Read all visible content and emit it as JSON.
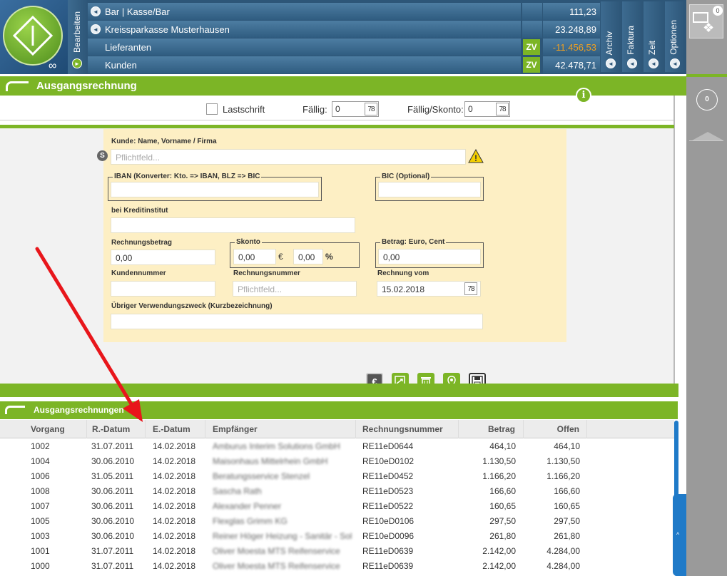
{
  "toolbar": {
    "edit_label": "Bearbeiten",
    "tabs": [
      "Archiv",
      "Faktura",
      "Zeit",
      "Optionen"
    ]
  },
  "accounts": [
    {
      "name": "Bar | Kasse/Bar",
      "badge": "",
      "amount": "111,23",
      "negative": false
    },
    {
      "name": "Kreissparkasse Musterhausen",
      "badge": "",
      "amount": "23.248,89",
      "negative": false
    },
    {
      "name": "Lieferanten",
      "badge": "ZV",
      "amount": "-11.456,53",
      "negative": true
    },
    {
      "name": "Kunden",
      "badge": "ZV",
      "amount": "42.478,71",
      "negative": false
    }
  ],
  "right_panel": {
    "mail_count": "0",
    "circle_count": "0"
  },
  "section": {
    "title": "Ausgangsrechnung",
    "info_icon": "i"
  },
  "options": {
    "lastschrift_label": "Lastschrift",
    "faellig_label": "Fällig:",
    "faellig_value": "0",
    "faellig_skonto_label": "Fällig/Skonto:",
    "faellig_skonto_value": "0",
    "cal_glyph": "78"
  },
  "form": {
    "kunde_label": "Kunde: Name, Vorname / Firma",
    "kunde_placeholder": "Pflichtfeld...",
    "s_badge": "S",
    "iban_legend": "IBAN (Konverter: Kto. => IBAN, BLZ => BIC",
    "bic_legend": "BIC (Optional)",
    "kreditinstitut_label": "bei Kreditinstitut",
    "rechnungsbetrag_label": "Rechnungsbetrag",
    "rechnungsbetrag_value": "0,00",
    "skonto_legend": "Skonto",
    "skonto_value": "0,00",
    "skonto_currency": "€",
    "skonto_percent_value": "0,00",
    "skonto_percent": "%",
    "betrag_legend": "Betrag: Euro, Cent",
    "betrag_value": "0,00",
    "kundennummer_label": "Kundennummer",
    "rechnungsnummer_label": "Rechnungsnummer",
    "rechnungsnummer_placeholder": "Pflichtfeld...",
    "rechnung_vom_label": "Rechnung vom",
    "rechnung_vom_value": "15.02.2018",
    "verwendung_label": "Übriger Verwendungszweck (Kurzbezeichnung)"
  },
  "list": {
    "title": "Ausgangsrechnungen",
    "columns": [
      "Vorgang",
      "R.-Datum",
      "E.-Datum",
      "Empfänger",
      "Rechnungsnummer",
      "Betrag",
      "Offen"
    ],
    "rows": [
      {
        "vorgang": "1002",
        "rdatum": "31.07.2011",
        "edatum": "14.02.2018",
        "empfaenger": "Amburus Interim Solutions GmbH",
        "nummer": "RE11eD0644",
        "betrag": "464,10",
        "offen": "464,10"
      },
      {
        "vorgang": "1004",
        "rdatum": "30.06.2010",
        "edatum": "14.02.2018",
        "empfaenger": "Maisonhaus Mittelrhein GmbH",
        "nummer": "RE10eD0102",
        "betrag": "1.130,50",
        "offen": "1.130,50"
      },
      {
        "vorgang": "1006",
        "rdatum": "31.05.2011",
        "edatum": "14.02.2018",
        "empfaenger": "Beratungsservice Stenzel",
        "nummer": "RE11eD0452",
        "betrag": "1.166,20",
        "offen": "1.166,20"
      },
      {
        "vorgang": "1008",
        "rdatum": "30.06.2011",
        "edatum": "14.02.2018",
        "empfaenger": "Sascha Rath",
        "nummer": "RE11eD0523",
        "betrag": "166,60",
        "offen": "166,60"
      },
      {
        "vorgang": "1007",
        "rdatum": "30.06.2011",
        "edatum": "14.02.2018",
        "empfaenger": "Alexander Penner",
        "nummer": "RE11eD0522",
        "betrag": "160,65",
        "offen": "160,65"
      },
      {
        "vorgang": "1005",
        "rdatum": "30.06.2010",
        "edatum": "14.02.2018",
        "empfaenger": "Flexglas Grimm KG",
        "nummer": "RE10eD0106",
        "betrag": "297,50",
        "offen": "297,50"
      },
      {
        "vorgang": "1003",
        "rdatum": "30.06.2010",
        "edatum": "14.02.2018",
        "empfaenger": "Reiner Höger Heizung - Sanitär - Sol",
        "nummer": "RE10eD0096",
        "betrag": "261,80",
        "offen": "261,80"
      },
      {
        "vorgang": "1001",
        "rdatum": "31.07.2011",
        "edatum": "14.02.2018",
        "empfaenger": "Oliver Moesta MTS Reifenservice",
        "nummer": "RE11eD0639",
        "betrag": "2.142,00",
        "offen": "4.284,00"
      },
      {
        "vorgang": "1000",
        "rdatum": "31.07.2011",
        "edatum": "14.02.2018",
        "empfaenger": "Oliver Moesta MTS Reifenservice",
        "nummer": "RE11eD0639",
        "betrag": "2.142,00",
        "offen": "4.284,00"
      }
    ]
  },
  "colors": {
    "green": "#7cb526",
    "blue": "#2f5c80",
    "negative": "#f0a020",
    "form_bg": "#fdefc4"
  }
}
